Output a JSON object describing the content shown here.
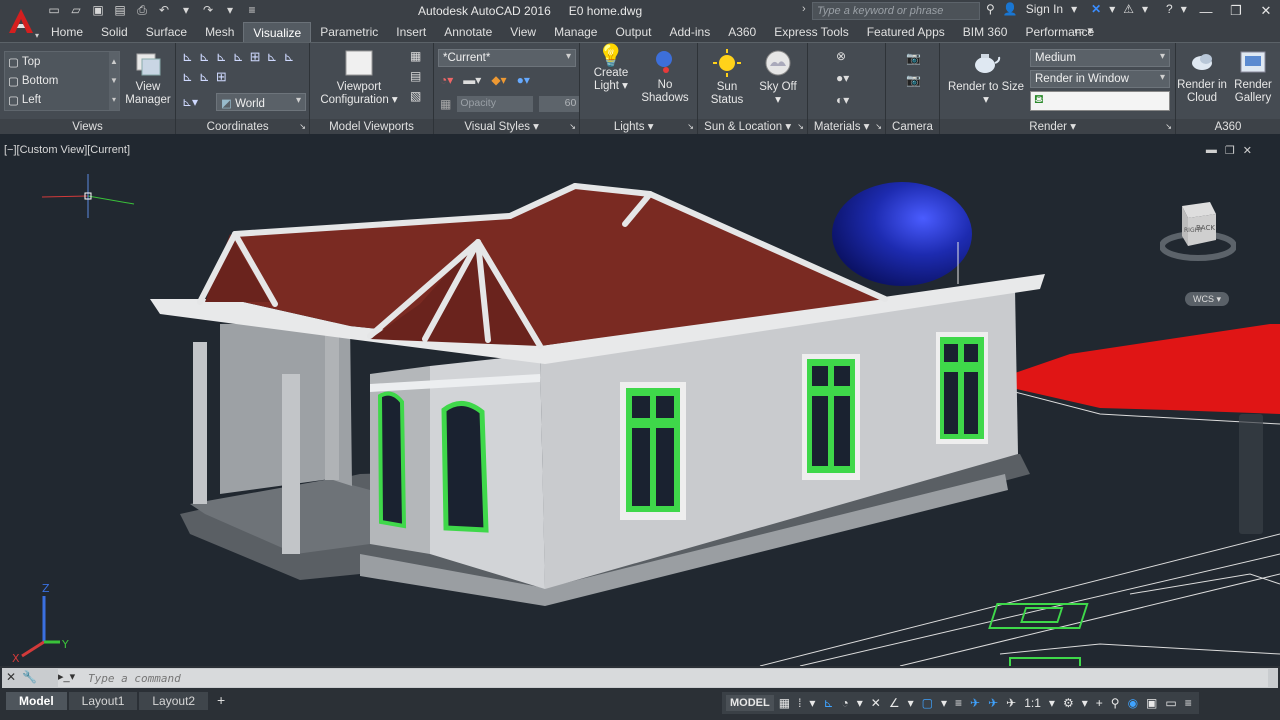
{
  "title_bar": {
    "app_name": "Autodesk AutoCAD 2016",
    "file_name": "E0 home.dwg",
    "search_placeholder": "Type a keyword or phrase",
    "sign_in": "Sign In"
  },
  "ribbon_tabs": [
    "Home",
    "Solid",
    "Surface",
    "Mesh",
    "Visualize",
    "Parametric",
    "Insert",
    "Annotate",
    "View",
    "Manage",
    "Output",
    "Add-ins",
    "A360",
    "Express Tools",
    "Featured Apps",
    "BIM 360",
    "Performance"
  ],
  "active_tab": "Visualize",
  "panels": {
    "views": {
      "title": "Views",
      "items": [
        "Top",
        "Bottom",
        "Left"
      ],
      "view_manager": [
        "View",
        "Manager"
      ]
    },
    "coordinates": {
      "title": "Coordinates",
      "ucs_combo": "World"
    },
    "model_viewports": {
      "title": "Model Viewports",
      "viewport_config": [
        "Viewport",
        "Configuration"
      ]
    },
    "visual_styles": {
      "title": "Visual Styles",
      "style_combo": "*Current*",
      "opacity_label": "Opacity",
      "opacity_value": "60"
    },
    "lights": {
      "title": "Lights",
      "create_light": [
        "Create",
        "Light"
      ],
      "no_shadows": [
        "No",
        "Shadows"
      ]
    },
    "sun_location": {
      "title": "Sun & Location",
      "sun_status": [
        "Sun",
        "Status"
      ],
      "sky_off": [
        "Sky Off",
        ""
      ]
    },
    "materials": {
      "title": "Materials"
    },
    "camera": {
      "title": "Camera"
    },
    "render": {
      "title": "Render",
      "render_to_size": "Render to Size",
      "quality_combo": "Medium",
      "render_in_combo": "Render in Window"
    },
    "a360": {
      "title": "A360",
      "render_cloud": [
        "Render in",
        "Cloud"
      ],
      "render_gallery": [
        "Render",
        "Gallery"
      ]
    }
  },
  "viewport": {
    "label": "[−][Custom View][Current]",
    "viewcube_faces": [
      "RIGHT",
      "BACK"
    ],
    "wcs_label": "WCS",
    "axis_labels": [
      "Z",
      "Y",
      "X"
    ]
  },
  "command_line": {
    "placeholder": "Type a command"
  },
  "status_bar": {
    "layout_tabs": [
      "Model",
      "Layout1",
      "Layout2"
    ],
    "add_tab": "+",
    "model_label": "MODEL",
    "scale": "1:1"
  },
  "colors": {
    "roof": "#7a2a22",
    "wall": "#c9cbce",
    "window_frame": "#3fd84a",
    "sphere": "#1d2bb0",
    "plan_red": "#e01515",
    "background": "#212830"
  }
}
